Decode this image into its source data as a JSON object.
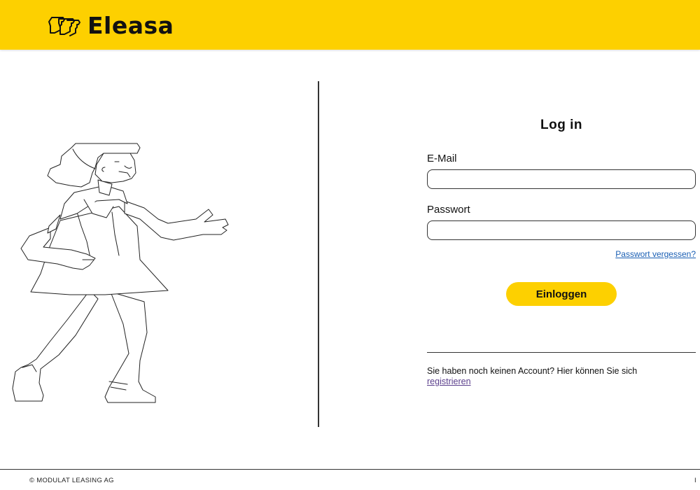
{
  "header": {
    "brand": "Eleasa",
    "brand_color": "#fdd000"
  },
  "login": {
    "title": "Log in",
    "email_label": "E-Mail",
    "email_value": "",
    "password_label": "Passwort",
    "password_value": "",
    "forgot_link": "Passwort vergessen?",
    "login_button": "Einloggen",
    "register_prompt": "Sie haben noch keinen Account? Hier können Sie sich",
    "register_link": "registrieren"
  },
  "footer": {
    "copyright": "© MODULAT LEASING AG",
    "right_text": "I"
  }
}
